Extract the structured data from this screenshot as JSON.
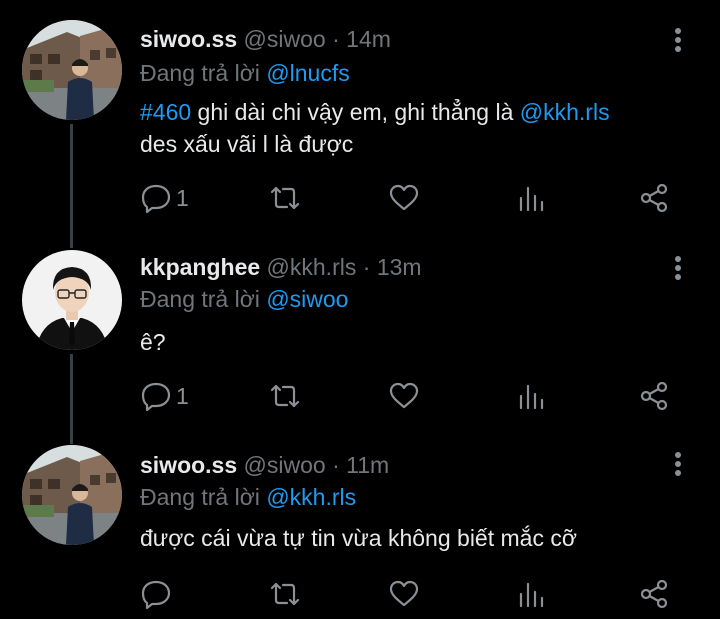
{
  "colors": {
    "background": "#000000",
    "link": "#1d9bf0",
    "muted": "#71767b",
    "text": "#e7e9ea"
  },
  "tweets": [
    {
      "name": "siwoo.ss",
      "handle": "@siwoo",
      "sep": "·",
      "time": "14m",
      "reply_prefix": "Đang trả lời",
      "reply_to": "@lnucfs",
      "line1_tag": "#460",
      "line1_text": " ghi dài chi vậy em, ghi thẳng là ",
      "line1_mention": "@kkh.rls",
      "line2": "des xấu vãi l là được",
      "reply_count": "1",
      "avatar": "street-photo"
    },
    {
      "name": "kkpanghee",
      "handle": "@kkh.rls",
      "sep": "·",
      "time": "13m",
      "reply_prefix": "Đang trả lời",
      "reply_to": "@siwoo",
      "text": "ê?",
      "reply_count": "1",
      "avatar": "portrait-suit"
    },
    {
      "name": "siwoo.ss",
      "handle": "@siwoo",
      "sep": "·",
      "time": "11m",
      "reply_prefix": "Đang trả lời",
      "reply_to": "@kkh.rls",
      "text": "được cái vừa tự tin vừa không biết mắc cỡ",
      "reply_count": "",
      "avatar": "street-photo"
    }
  ],
  "icons": [
    "reply-icon",
    "retweet-icon",
    "like-icon",
    "analytics-icon",
    "share-icon",
    "more-icon"
  ]
}
